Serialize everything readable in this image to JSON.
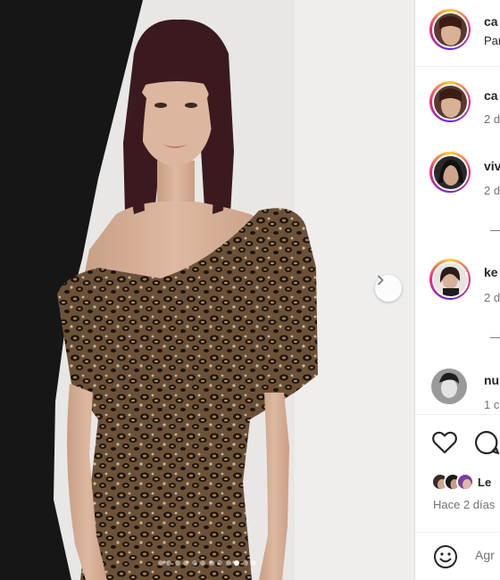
{
  "post": {
    "image_alt": "Woman in leopard-print off-shoulder dress",
    "carousel": {
      "total": 12,
      "active_index": 9
    }
  },
  "header": {
    "username": "ca",
    "subtitle": "Par"
  },
  "comments": [
    {
      "username": "ca",
      "time": "2 d"
    },
    {
      "username": "viv",
      "time": "2 d",
      "replies_marker": "—"
    },
    {
      "username": "ke",
      "time": "2 d",
      "replies_marker": "—"
    },
    {
      "username": "nu",
      "time": "1 c"
    }
  ],
  "likes": {
    "text": "Le"
  },
  "date": "Hace 2 días",
  "comment_box": {
    "placeholder": "Agr"
  },
  "colors": {
    "story_ring": [
      "#f9ce34",
      "#ee2a7b",
      "#6228d7"
    ],
    "text_primary": "#262626",
    "text_secondary": "#737373",
    "divider": "#dbdbdb"
  },
  "icons": [
    "chevron-right-icon",
    "heart-icon",
    "comment-icon",
    "emoji-icon"
  ]
}
